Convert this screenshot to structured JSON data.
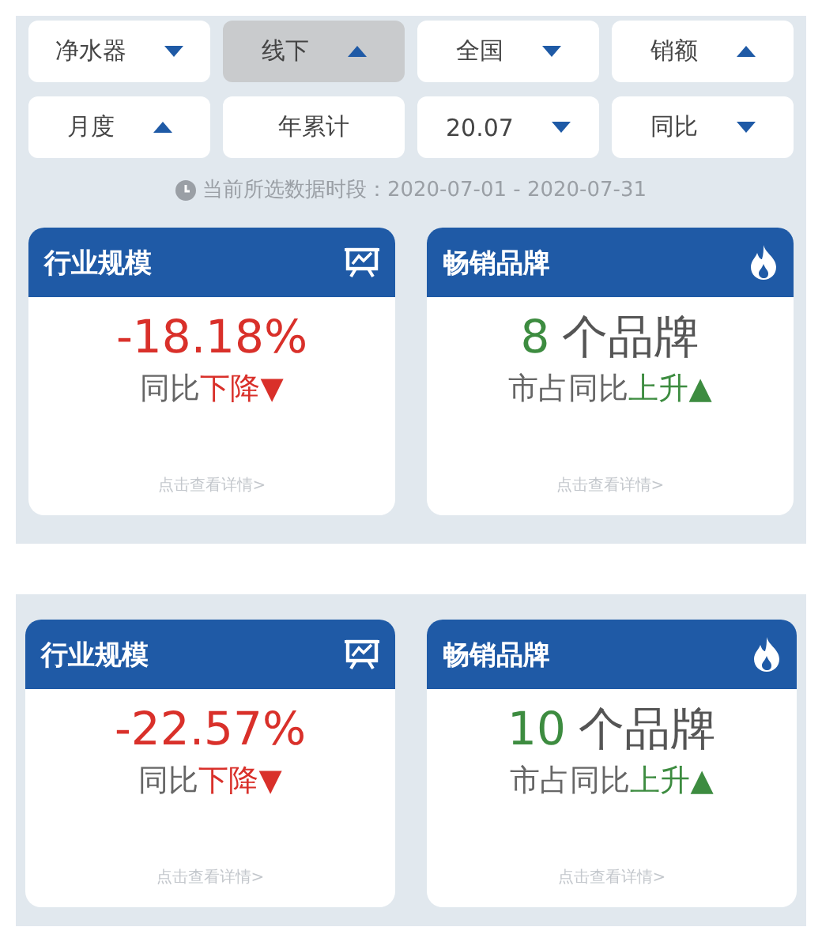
{
  "screens": [
    {
      "filters": [
        {
          "label": "净水器",
          "kind": "down",
          "selected": false
        },
        {
          "label": "线下",
          "kind": "up",
          "selected": true
        },
        {
          "label": "全国",
          "kind": "down",
          "selected": false
        },
        {
          "label": "销额",
          "kind": "up",
          "selected": false
        },
        {
          "label": "月度",
          "kind": "up",
          "selected": false
        },
        {
          "label": "年累计",
          "kind": "plain",
          "selected": false
        },
        {
          "label": "20.07",
          "kind": "down",
          "selected": false
        },
        {
          "label": "同比",
          "kind": "down",
          "selected": false
        }
      ],
      "period": "当前所选数据时段：2020-07-01 - 2020-07-31",
      "cards": [
        {
          "title": "行业规模",
          "kind": "chart",
          "value": "-18.18%",
          "trend_prefix": "同比",
          "trend": "下降▼",
          "rising": false,
          "link": "点击查看详情>"
        },
        {
          "title": "畅销品牌",
          "kind": "flame",
          "value": "8",
          "unit": "个品牌",
          "trend_prefix": "市占同比",
          "trend": "上升▲",
          "rising": true,
          "link": "点击查看详情>"
        }
      ]
    },
    {
      "cards": [
        {
          "title": "行业规模",
          "kind": "chart",
          "value": "-22.57%",
          "trend_prefix": "同比",
          "trend": "下降▼",
          "rising": false,
          "link": "点击查看详情>"
        },
        {
          "title": "畅销品牌",
          "kind": "flame",
          "value": "10",
          "unit": "个品牌",
          "trend_prefix": "市占同比",
          "trend": "上升▲",
          "rising": true,
          "link": "点击查看详情>"
        }
      ]
    }
  ]
}
